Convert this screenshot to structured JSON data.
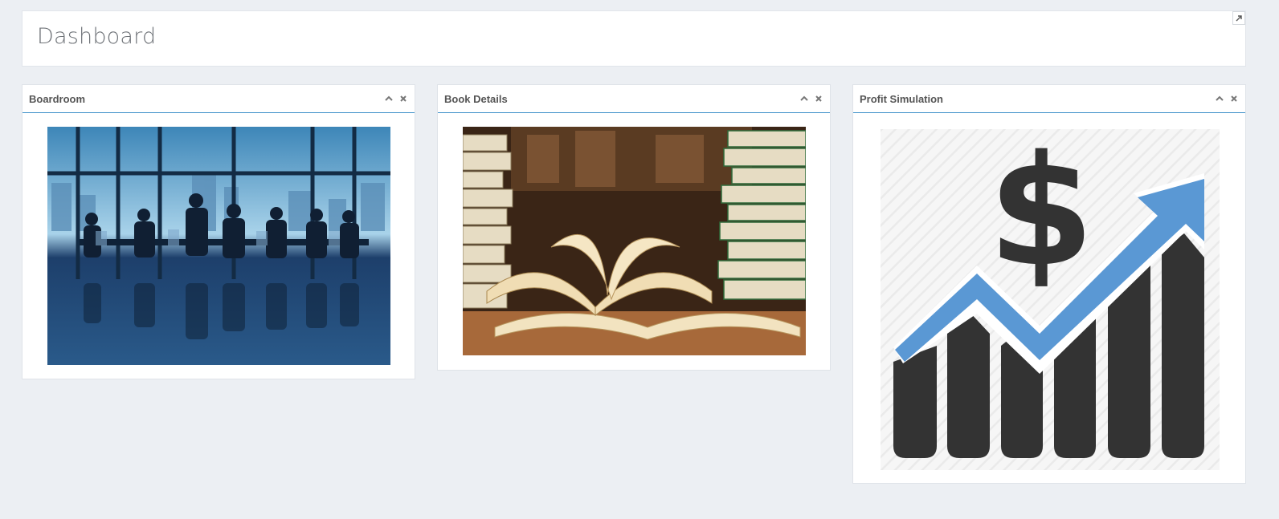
{
  "header": {
    "title": "Dashboard"
  },
  "widgets": [
    {
      "title": "Boardroom"
    },
    {
      "title": "Book Details"
    },
    {
      "title": "Profit Simulation"
    }
  ],
  "icons": {
    "expand": "expand-icon",
    "collapse": "chevron-up-icon",
    "close": "close-icon"
  },
  "colors": {
    "accent": "#3a8fc8",
    "background": "#eceff3",
    "arrow": "#5a98d4",
    "bars": "#333333"
  }
}
